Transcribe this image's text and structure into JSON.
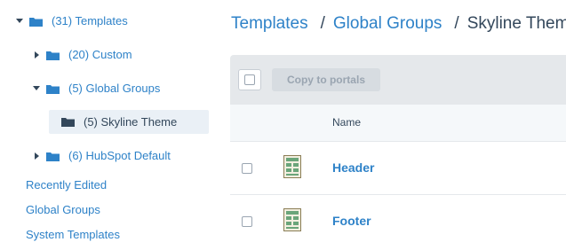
{
  "sidebar": {
    "tree": [
      {
        "label": "(31) Templates",
        "expanded": true
      },
      {
        "label": "(20) Custom",
        "expanded": false
      },
      {
        "label": "(5) Global Groups",
        "expanded": true
      },
      {
        "label": "(5) Skyline Theme",
        "selected": true
      },
      {
        "label": "(6) HubSpot Default",
        "expanded": false
      }
    ],
    "links": [
      "Recently Edited",
      "Global Groups",
      "System Templates"
    ]
  },
  "breadcrumb": {
    "items": [
      "Templates",
      "Global Groups"
    ],
    "separator": "/",
    "current": "Skyline Theme"
  },
  "toolbar": {
    "copy_label": "Copy to portals"
  },
  "table": {
    "columns": [
      "Name"
    ],
    "rows": [
      {
        "name": "Header",
        "icon": "template-icon"
      },
      {
        "name": "Footer",
        "icon": "template-icon"
      }
    ]
  },
  "colors": {
    "link": "#2e82c8",
    "text": "#33475b",
    "folder_blue": "#2e82c8",
    "folder_dark": "#33475b",
    "toolbar_bg": "#e5e8eb",
    "selected_bg": "#eaf0f6"
  }
}
